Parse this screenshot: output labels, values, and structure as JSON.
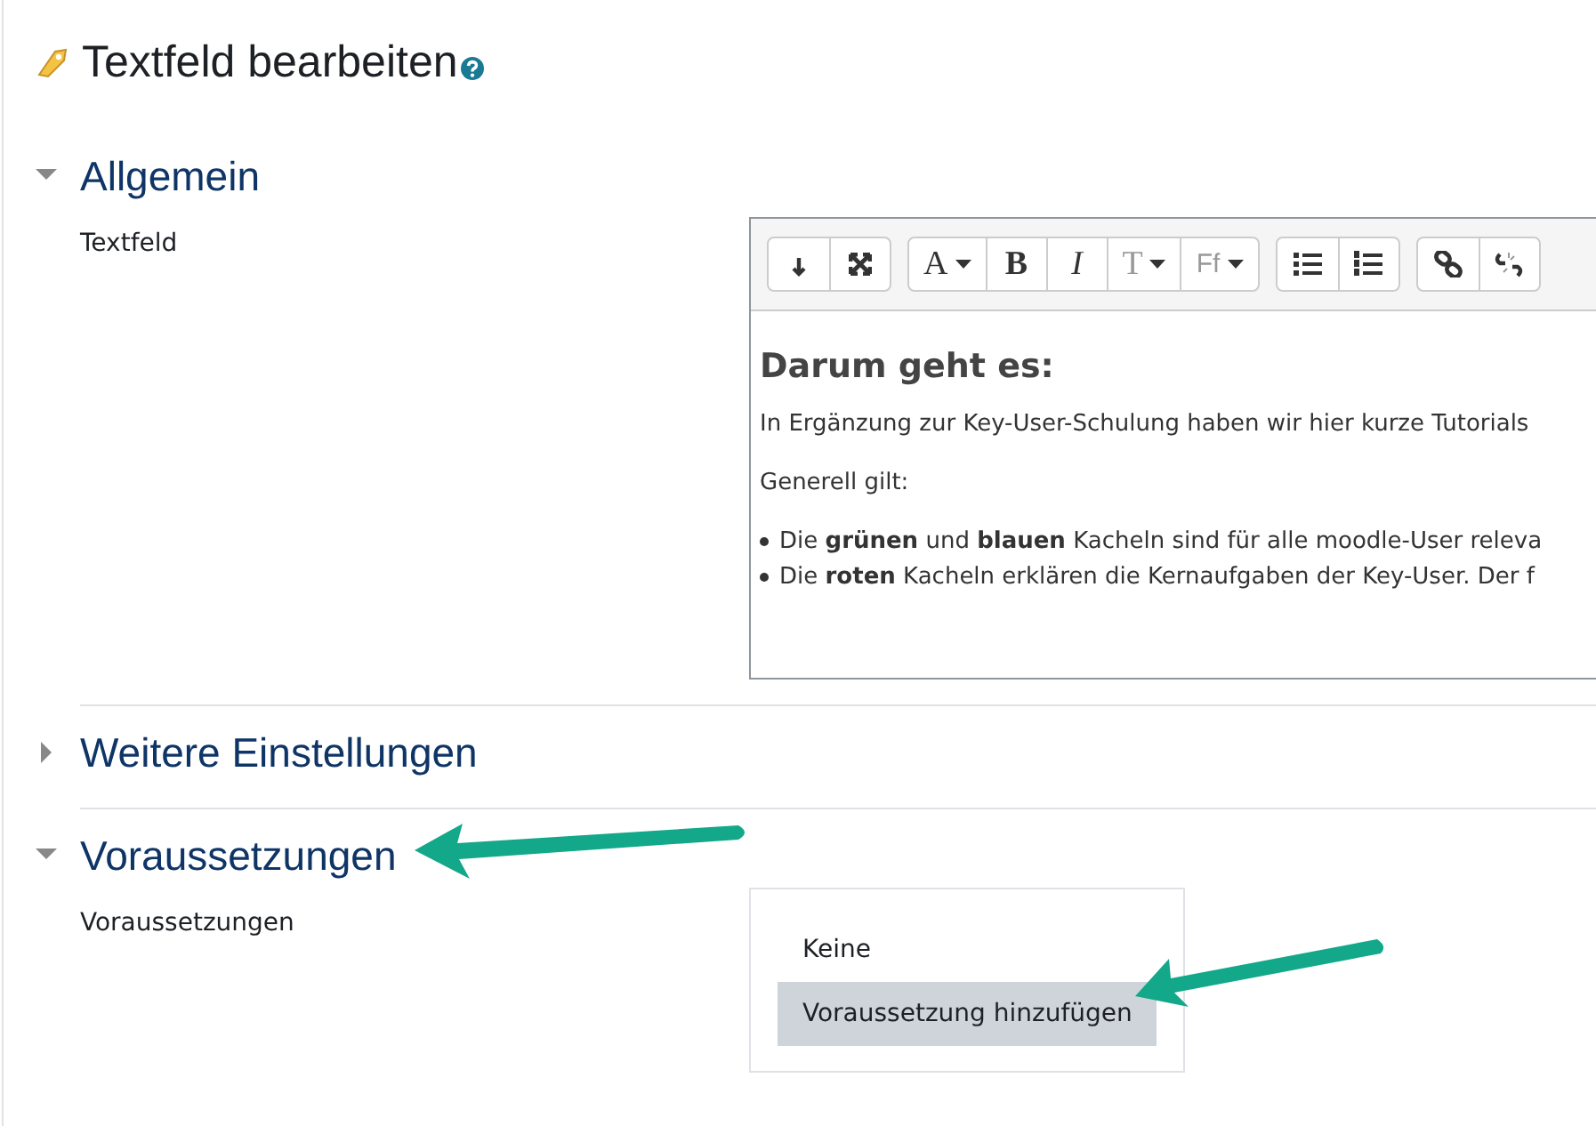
{
  "page": {
    "title": "Textfeld bearbeiten"
  },
  "sections": [
    {
      "title": "Allgemein",
      "expanded": true,
      "fields": [
        {
          "kind": "editor",
          "label": "Textfeld",
          "toolbar": [
            [
              {
                "kind": "collapse"
              },
              {
                "kind": "expand"
              }
            ],
            [
              {
                "kind": "fontcolor",
                "label": "A",
                "dropdown": true
              },
              {
                "kind": "bold",
                "label": "B"
              },
              {
                "kind": "italic",
                "label": "I"
              },
              {
                "kind": "fontsize",
                "label": "T",
                "dropdown": true
              },
              {
                "kind": "fontfamily",
                "label": "Ff",
                "dropdown": true
              }
            ],
            [
              {
                "kind": "bullets"
              },
              {
                "kind": "numbers"
              }
            ],
            [
              {
                "kind": "link"
              },
              {
                "kind": "unlink"
              }
            ]
          ],
          "content": [
            {
              "kind": "heading",
              "text": "Darum geht es:"
            },
            {
              "kind": "paragraph",
              "text": "In Ergänzung zur Key-User-Schulung haben wir hier kurze Tutorials"
            },
            {
              "kind": "paragraph",
              "text": "Generell gilt:"
            },
            {
              "kind": "bullet",
              "text": "Die **grünen** und **blauen** Kacheln sind für alle moodle-User releva"
            },
            {
              "kind": "bullet",
              "text": "Die **roten** Kacheln erklären die Kernaufgaben der Key-User. Der f"
            }
          ]
        }
      ]
    },
    {
      "title": "Weitere Einstellungen",
      "expanded": false
    },
    {
      "title": "Voraussetzungen",
      "expanded": true,
      "fields": [
        {
          "kind": "menu",
          "label": "Voraussetzungen",
          "options": [
            {
              "label": "Keine",
              "selected": false
            },
            {
              "label": "Voraussetzung hinzufügen",
              "selected": true
            }
          ]
        }
      ]
    }
  ]
}
